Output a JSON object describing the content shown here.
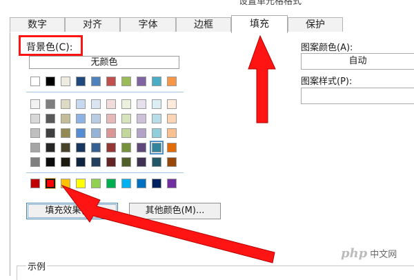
{
  "window": {
    "title": "设置单元格格式"
  },
  "tabs": [
    {
      "label": "数字",
      "active": false
    },
    {
      "label": "对齐",
      "active": false
    },
    {
      "label": "字体",
      "active": false
    },
    {
      "label": "边框",
      "active": false
    },
    {
      "label": "填充",
      "active": true
    },
    {
      "label": "保护",
      "active": false
    }
  ],
  "fill": {
    "background_label": "背景色(C):",
    "no_color_label": "无颜色",
    "theme_top_row": [
      "#ffffff",
      "#000000",
      "#eeece1",
      "#1f497d",
      "#4f81bd",
      "#c0504d",
      "#9bbb59",
      "#8064a2",
      "#4bacc6",
      "#f79646"
    ],
    "theme_shades": [
      [
        "#f2f2f2",
        "#7f7f7f",
        "#ddd9c3",
        "#c6d9f0",
        "#dbe5f1",
        "#f2dcdb",
        "#ebf1dd",
        "#e5e0ec",
        "#dbeef3",
        "#fdeada"
      ],
      [
        "#d8d8d8",
        "#595959",
        "#c4bd97",
        "#8db3e2",
        "#b8cce4",
        "#e5b9b7",
        "#d7e3bc",
        "#ccc1d9",
        "#b7dde8",
        "#fbd5b5"
      ],
      [
        "#bfbfbf",
        "#3f3f3f",
        "#938953",
        "#548dd4",
        "#95b3d7",
        "#d99694",
        "#c3d69b",
        "#b2a2c7",
        "#92cddc",
        "#fac08f"
      ],
      [
        "#a5a5a5",
        "#262626",
        "#494429",
        "#17365d",
        "#366092",
        "#953734",
        "#76923c",
        "#5f497a",
        "#31859b",
        "#e36c09"
      ],
      [
        "#7f7f7f",
        "#0c0c0c",
        "#1d1b10",
        "#0f243e",
        "#244061",
        "#632423",
        "#4f6128",
        "#3f3151",
        "#205867",
        "#974806"
      ]
    ],
    "standard_colors": [
      "#c00000",
      "#ff0000",
      "#ffc000",
      "#ffff00",
      "#92d050",
      "#00b050",
      "#00b0f0",
      "#0070c0",
      "#002060",
      "#7030a0"
    ],
    "selected_standard_color": "#ff0000",
    "highlighted_theme_color": "#31859b",
    "fill_effects_button": "填充效果(I)...",
    "more_colors_button": "其他颜色(M)...",
    "pattern_color_label": "图案颜色(A):",
    "pattern_color_value": "自动",
    "pattern_style_label": "图案样式(P):",
    "pattern_style_value": ""
  },
  "sample": {
    "label": "示例"
  },
  "watermark": {
    "logo_text": "php",
    "site_text": "中文网"
  },
  "annotation": {
    "color": "#ff1414"
  }
}
